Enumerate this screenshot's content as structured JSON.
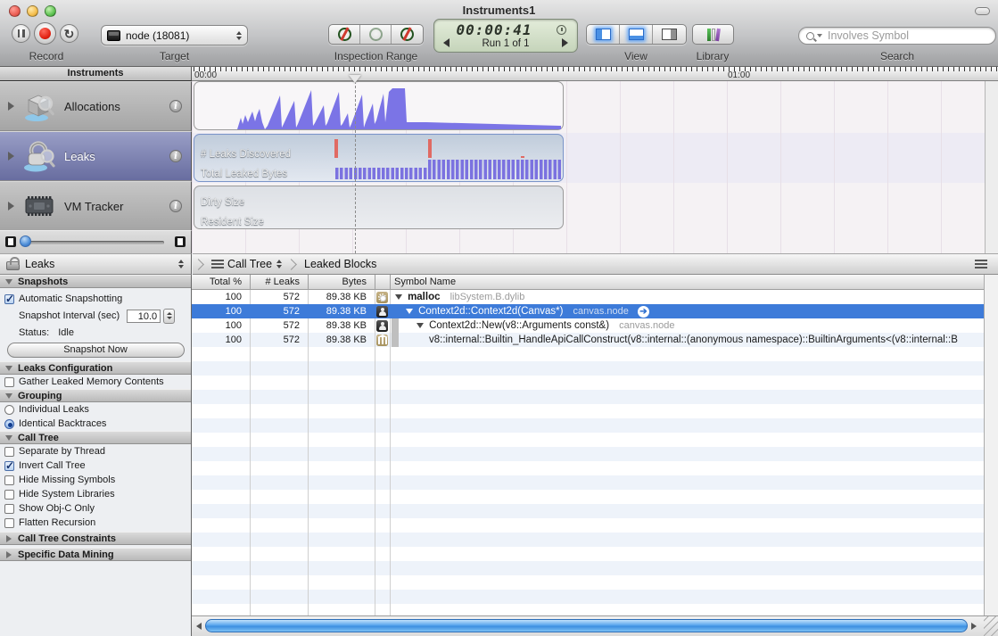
{
  "window": {
    "title": "Instruments1"
  },
  "toolbar": {
    "record_label": "Record",
    "target_label": "Target",
    "target_value": "node (18081)",
    "inspection_label": "Inspection Range",
    "time": "00:00:41",
    "run": "Run 1 of 1",
    "view_label": "View",
    "library_label": "Library",
    "search_label": "Search",
    "search_placeholder": "Involves Symbol"
  },
  "sidebar": {
    "header": "Instruments",
    "items": [
      {
        "label": "Allocations",
        "selected": false
      },
      {
        "label": "Leaks",
        "selected": true
      },
      {
        "label": "VM Tracker",
        "selected": false
      }
    ]
  },
  "timeline": {
    "t0": "00:00",
    "t1": "01:00"
  },
  "tracks": {
    "leaks_line1": "# Leaks Discovered",
    "leaks_line2": "Total Leaked Bytes",
    "vm_line1": "Dirty Size",
    "vm_line2": "Resident Size"
  },
  "inspector": {
    "selector": "Leaks",
    "snapshots": {
      "header": "Snapshots",
      "auto_label": "Automatic Snapshotting",
      "auto_checked": true,
      "interval_label": "Snapshot Interval (sec)",
      "interval_value": "10.0",
      "status_label": "Status:",
      "status_value": "Idle",
      "button": "Snapshot Now"
    },
    "leaks_config": {
      "header": "Leaks Configuration",
      "gather_label": "Gather Leaked Memory Contents",
      "gather_checked": false
    },
    "grouping": {
      "header": "Grouping",
      "individual_label": "Individual Leaks",
      "individual_selected": false,
      "identical_label": "Identical Backtraces",
      "identical_selected": true
    },
    "call_tree": {
      "header": "Call Tree",
      "items": [
        {
          "label": "Separate by Thread",
          "checked": false
        },
        {
          "label": "Invert Call Tree",
          "checked": true
        },
        {
          "label": "Hide Missing Symbols",
          "checked": false
        },
        {
          "label": "Hide System Libraries",
          "checked": false
        },
        {
          "label": "Show Obj-C Only",
          "checked": false
        },
        {
          "label": "Flatten Recursion",
          "checked": false
        }
      ]
    },
    "constraints_header": "Call Tree Constraints",
    "data_mining_header": "Specific Data Mining"
  },
  "breadcrumb": {
    "item1": "Call Tree",
    "item2": "Leaked Blocks"
  },
  "table": {
    "columns": {
      "total": "Total %",
      "leaks": "# Leaks",
      "bytes": "Bytes",
      "symbol": "Symbol Name"
    },
    "rows": [
      {
        "total": "100",
        "leaks": "572",
        "bytes": "89.38 KB",
        "icon": "gear",
        "symbol": "malloc",
        "lib": "libSystem.B.dylib",
        "selected": false
      },
      {
        "total": "100",
        "leaks": "572",
        "bytes": "89.38 KB",
        "icon": "person",
        "symbol": "Context2d::Context2d(Canvas*)",
        "lib": "canvas.node",
        "selected": true
      },
      {
        "total": "100",
        "leaks": "572",
        "bytes": "89.38 KB",
        "icon": "person",
        "symbol": "Context2d::New(v8::Arguments const&)",
        "lib": "canvas.node",
        "selected": false
      },
      {
        "total": "100",
        "leaks": "572",
        "bytes": "89.38 KB",
        "icon": "bank",
        "symbol": "v8::internal::Builtin_HandleApiCallConstruct(v8::internal::(anonymous namespace)::BuiltinArguments<(v8::internal::B",
        "lib": "",
        "selected": false
      }
    ]
  },
  "colors": {
    "selection_blue": "#3d7bd9",
    "instrument_selected": "#787da8",
    "waveform_purple": "#7b72e0",
    "leak_marker_red": "#e06a63",
    "scrollbar_aqua": "#5aa7ee",
    "lcd_green": "#d5e2ca"
  }
}
